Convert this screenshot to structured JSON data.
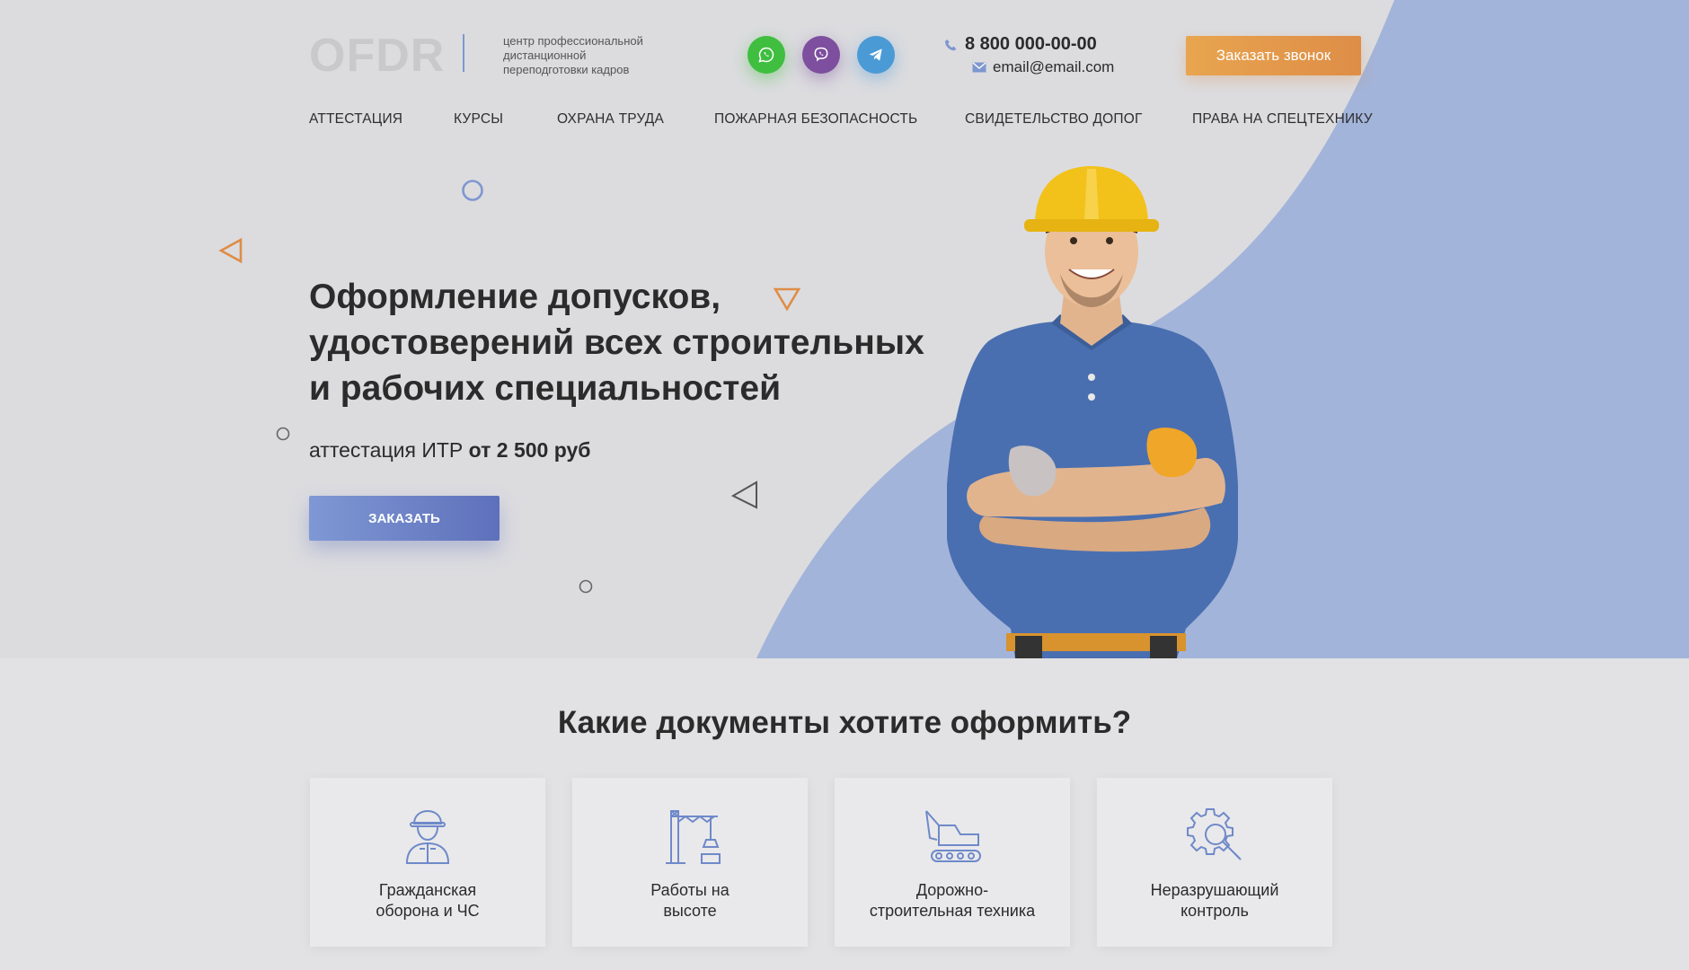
{
  "header": {
    "logo": "OFDR",
    "tagline": "центр профессиональной дистанционной переподготовки кадров",
    "phone": "8 800 000-00-00",
    "email": "email@email.com",
    "callback_label": "Заказать звонок"
  },
  "social": [
    "whatsapp-icon",
    "viber-icon",
    "telegram-icon"
  ],
  "nav": {
    "items": [
      {
        "label": "АТТЕСТАЦИЯ"
      },
      {
        "label": "КУРСЫ"
      },
      {
        "label": "ОХРАНА ТРУДА"
      },
      {
        "label": "ПОЖАРНАЯ БЕЗОПАСНОСТЬ"
      },
      {
        "label": "СВИДЕТЕЛЬСТВО ДОПОГ"
      },
      {
        "label": "ПРАВА НА СПЕЦТЕХНИКУ"
      }
    ]
  },
  "hero": {
    "headline_line1": "Оформление допусков,",
    "headline_line2": "удостоверений всех строительных",
    "headline_line3": "и рабочих специальностей",
    "price_prefix": "аттестация ИТР",
    "price_value": "от 2 500 руб",
    "order_label": "ЗАКАЗАТЬ"
  },
  "documents": {
    "title": "Какие документы хотите оформить?",
    "cards": [
      {
        "line1": "Гражданская",
        "line2": "оборона и ЧС",
        "icon": "worker-icon"
      },
      {
        "line1": "Работы на",
        "line2": "высоте",
        "icon": "crane-icon"
      },
      {
        "line1": "Дорожно-",
        "line2": "строительная техника",
        "icon": "excavator-icon"
      },
      {
        "line1": "Неразрушающий",
        "line2": "контроль",
        "icon": "gear-search-icon"
      }
    ]
  },
  "colors": {
    "accent_blue": "#a3b4da",
    "button_blue": "#6a7fc4",
    "accent_orange": "#e39a4b",
    "background": "#dcdcdf"
  }
}
